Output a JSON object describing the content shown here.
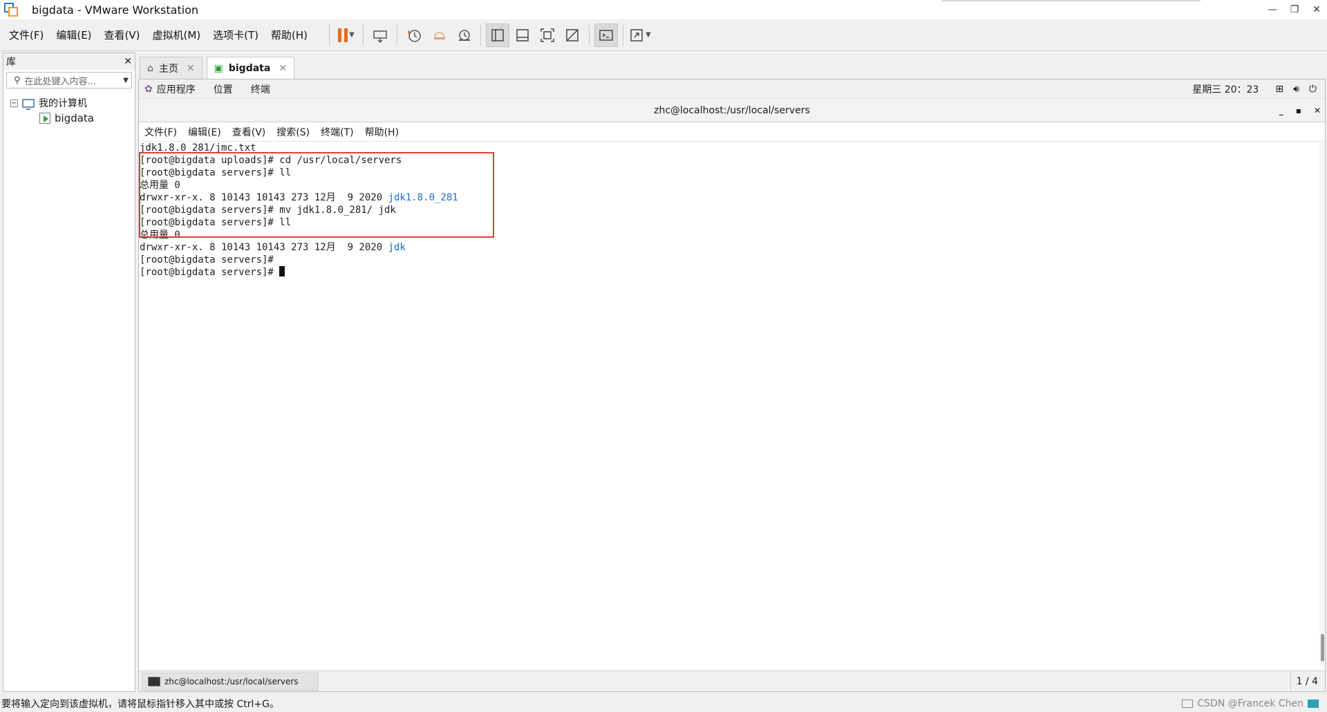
{
  "window": {
    "title": "bigdata - VMware Workstation"
  },
  "menu": [
    "文件(F)",
    "编辑(E)",
    "查看(V)",
    "虚拟机(M)",
    "选项卡(T)",
    "帮助(H)"
  ],
  "library": {
    "title": "库",
    "search_placeholder": "在此处键入内容...",
    "tree": {
      "root": "我的计算机",
      "child": "bigdata"
    }
  },
  "tabs": [
    {
      "label": "主页"
    },
    {
      "label": "bigdata"
    }
  ],
  "gnome": {
    "apps": "应用程序",
    "places": "位置",
    "terminal": "终端",
    "clock": "星期三 20：23"
  },
  "terminal": {
    "title": "zhc@localhost:/usr/local/servers",
    "menu": [
      "文件(F)",
      "编辑(E)",
      "查看(V)",
      "搜索(S)",
      "终端(T)",
      "帮助(H)"
    ],
    "lines": [
      "jdk1.8.0_281/jmc.txt",
      "[root@bigdata uploads]# cd /usr/local/servers",
      "[root@bigdata servers]# ll",
      "总用量 0",
      "drwxr-xr-x. 8 10143 10143 273 12月  9 2020 ",
      "[root@bigdata servers]# mv jdk1.8.0_281/ jdk",
      "[root@bigdata servers]# ll",
      "总用量 0",
      "drwxr-xr-x. 8 10143 10143 273 12月  9 2020 ",
      "[root@bigdata servers]#",
      "[root@bigdata servers]# "
    ],
    "dir_1": "jdk1.8.0_281",
    "dir_2": "jdk"
  },
  "taskbar": {
    "item": "zhc@localhost:/usr/local/servers",
    "page": "1 / 4"
  },
  "status": {
    "hint": "要将输入定向到该虚拟机，请将鼠标指针移入其中或按 Ctrl+G。",
    "watermark": "CSDN @Francek Chen"
  }
}
